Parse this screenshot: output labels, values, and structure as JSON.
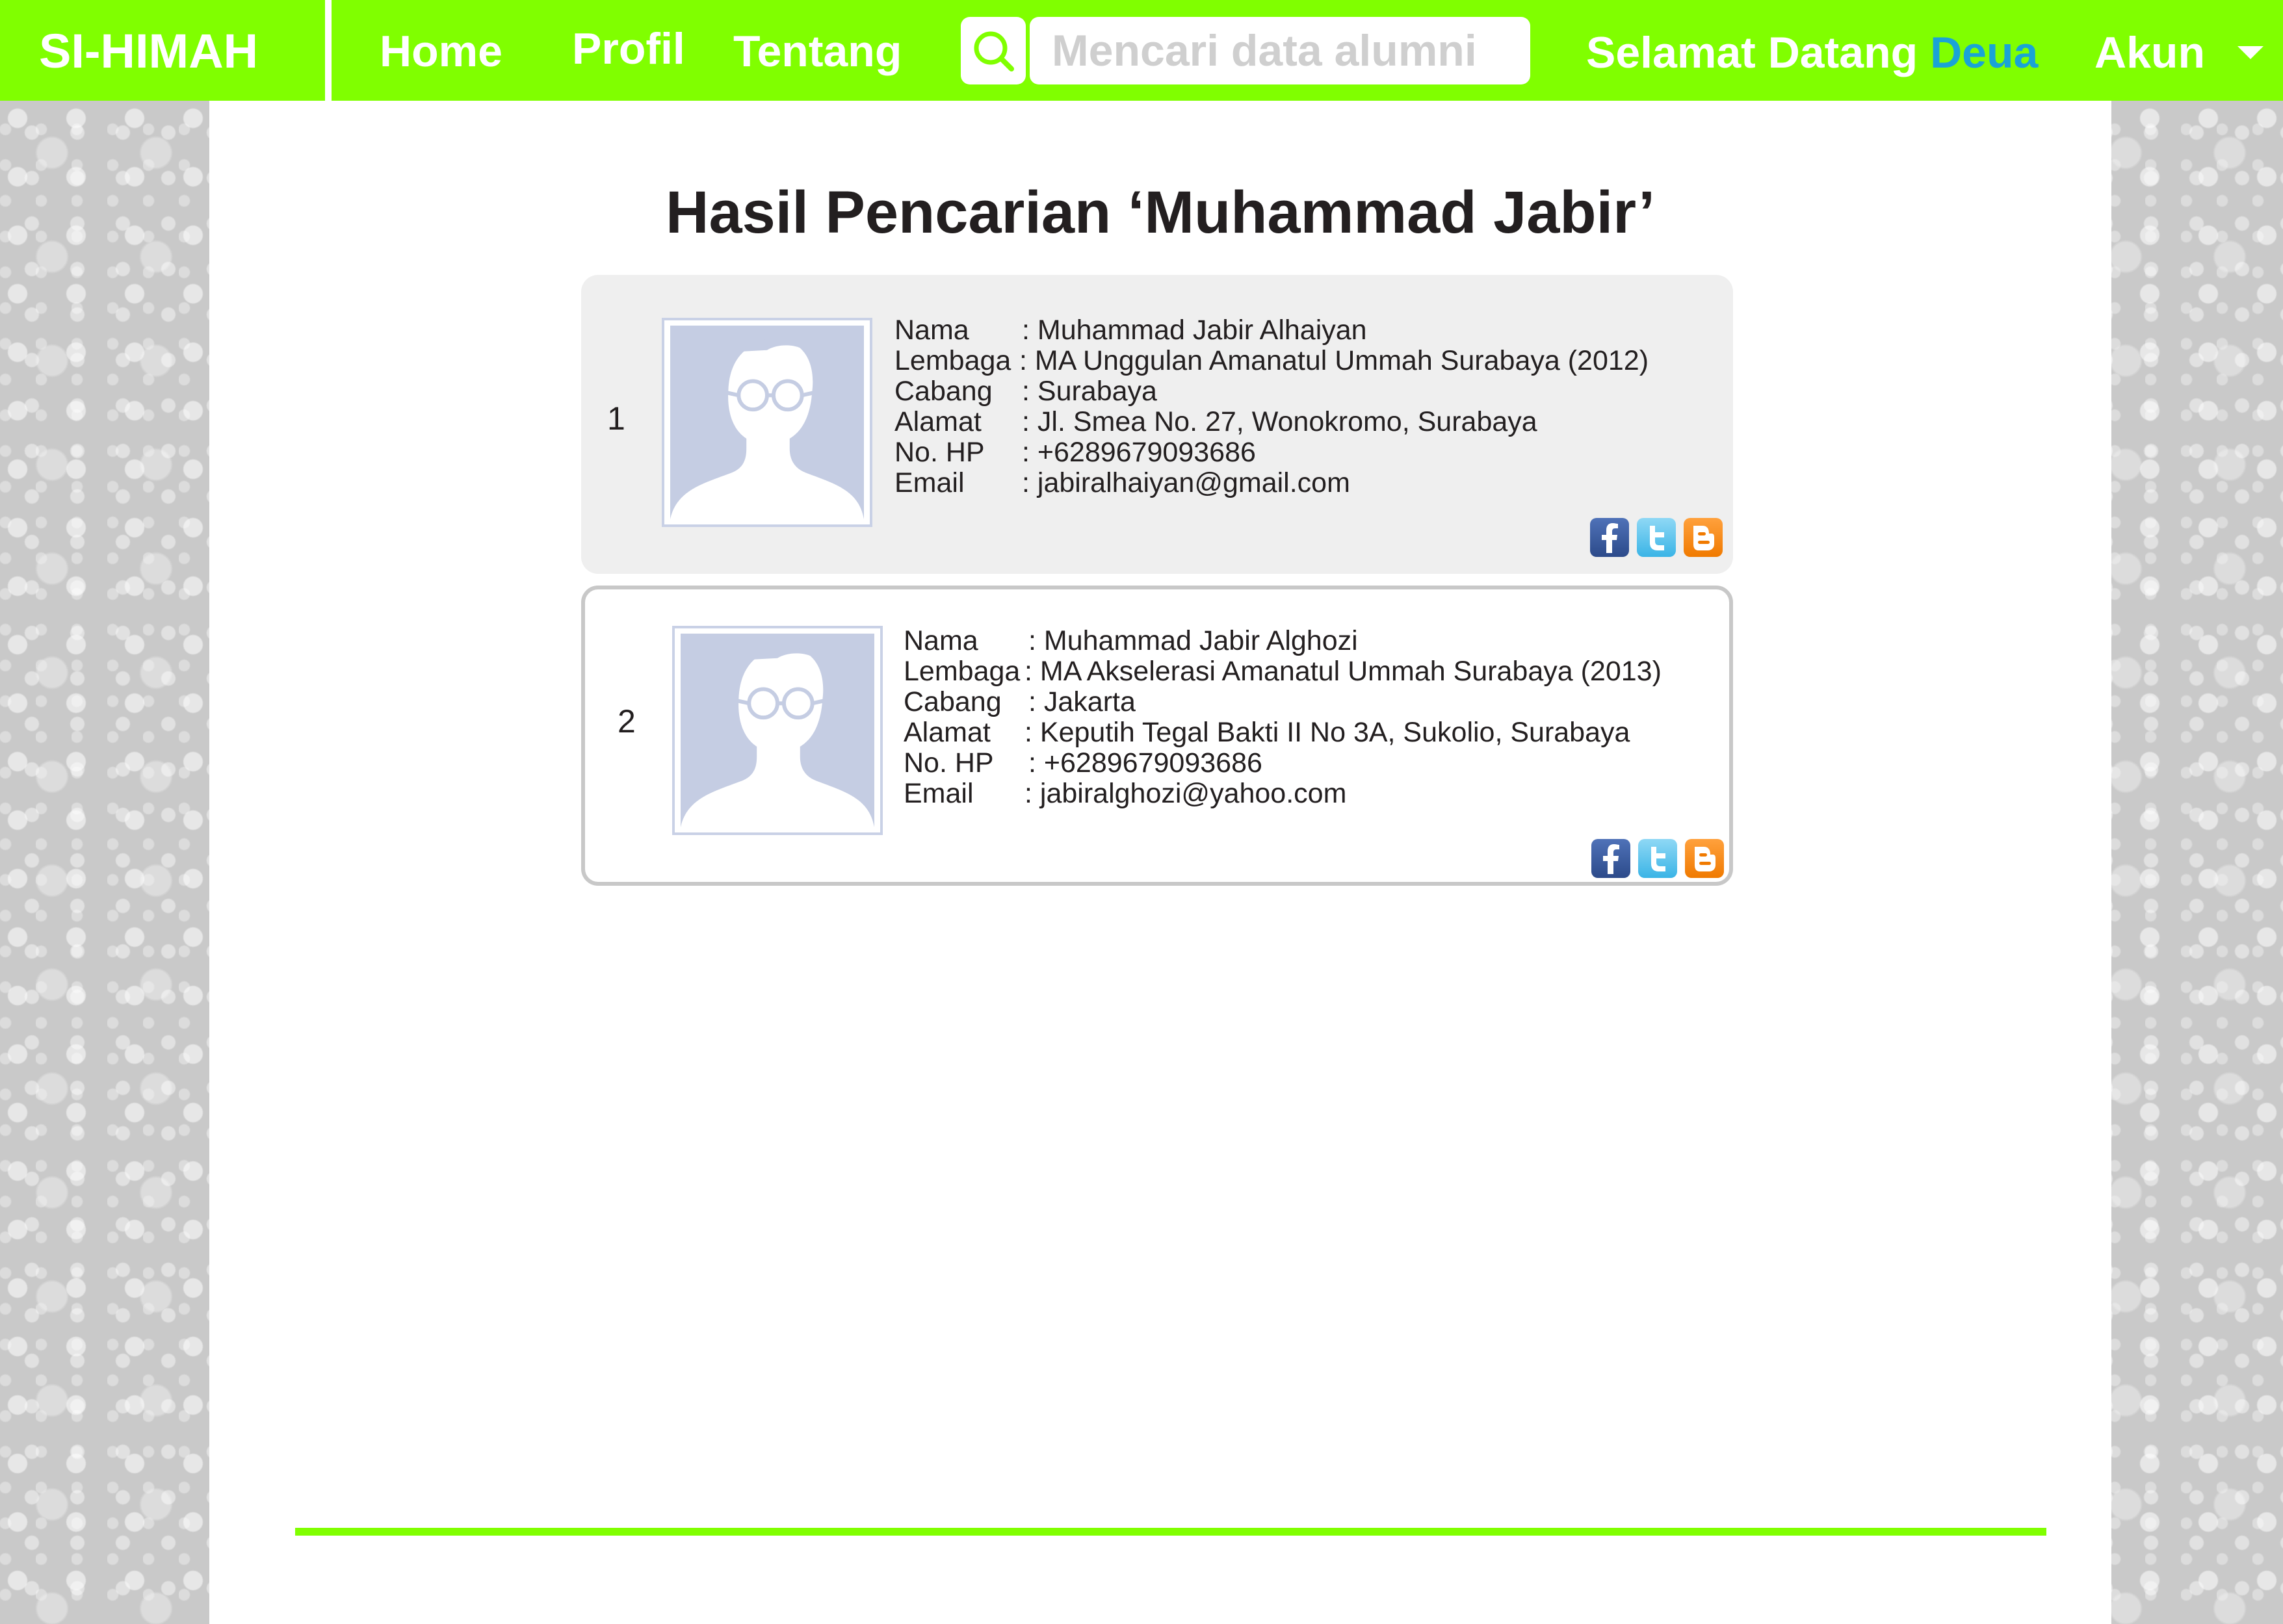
{
  "navbar": {
    "brand": "SI-HIMAH",
    "items": [
      "Home",
      "Profil",
      "Tentang"
    ],
    "search_placeholder": "Mencari data alumni",
    "welcome_prefix": "Selamat Datang",
    "welcome_user": "Deua",
    "account_label": "Akun"
  },
  "page": {
    "title": "Hasil Pencarian ‘Muhammad Jabir’"
  },
  "results": [
    {
      "number": "1",
      "fields": [
        {
          "label": "Nama",
          "value": ": Muhammad Jabir Alhaiyan"
        },
        {
          "label": "Lembaga",
          "value": ": MA Unggulan Amanatul Ummah Surabaya (2012)"
        },
        {
          "label": "Cabang",
          "value": ": Surabaya"
        },
        {
          "label": "Alamat",
          "value": ": Jl. Smea No. 27, Wonokromo, Surabaya"
        },
        {
          "label": "No. HP",
          "value": ": +6289679093686"
        },
        {
          "label": "Email",
          "value": ": jabiralhaiyan@gmail.com"
        }
      ]
    },
    {
      "number": "2",
      "fields": [
        {
          "label": "Nama",
          "value": ": Muhammad Jabir Alghozi"
        },
        {
          "label": "Lembaga",
          "value": ": MA Akselerasi Amanatul Ummah Surabaya (2013)"
        },
        {
          "label": "Cabang",
          "value": ": Jakarta"
        },
        {
          "label": "Alamat",
          "value": ": Keputih Tegal Bakti II No 3A, Sukolio, Surabaya"
        },
        {
          "label": "No. HP",
          "value": ": +6289679093686"
        },
        {
          "label": "Email",
          "value": ": jabiralghozi@yahoo.com"
        }
      ]
    }
  ],
  "colors": {
    "accent": "#80ff00",
    "username": "#1aa3d6",
    "card_bg": "#efefef"
  },
  "icons": [
    "search-icon",
    "chevron-down-icon",
    "avatar-placeholder-icon",
    "facebook-icon",
    "twitter-icon",
    "blogger-icon"
  ]
}
